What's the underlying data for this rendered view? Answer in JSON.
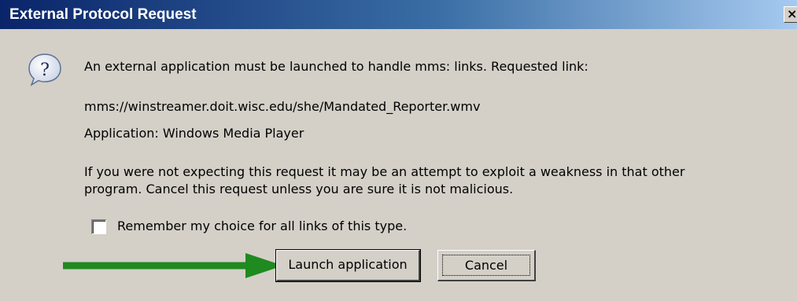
{
  "window": {
    "title": "External Protocol Request",
    "close_glyph": "×"
  },
  "dialog": {
    "message": "An external application must be launched to handle mms: links. Requested link:",
    "link": "mms://winstreamer.doit.wisc.edu/she/Mandated_Reporter.wmv",
    "application": "Application: Windows Media Player",
    "warning_line1": "If you were not expecting this request it may be an attempt to exploit a weakness in that other",
    "warning_line2": "program. Cancel this request unless you are sure it is not malicious.",
    "remember_label": "Remember my choice for all links of this type.",
    "remember_checked": false
  },
  "buttons": {
    "launch_label": "Launch application",
    "cancel_label": "Cancel"
  },
  "icons": {
    "dialog_icon": "question-icon",
    "annotation": "green-arrow-icon"
  },
  "colors": {
    "dialog_bg": "#d4d0c8",
    "title_start": "#0a246a",
    "title_end": "#a6caf0",
    "arrow": "#1f8a1f"
  }
}
